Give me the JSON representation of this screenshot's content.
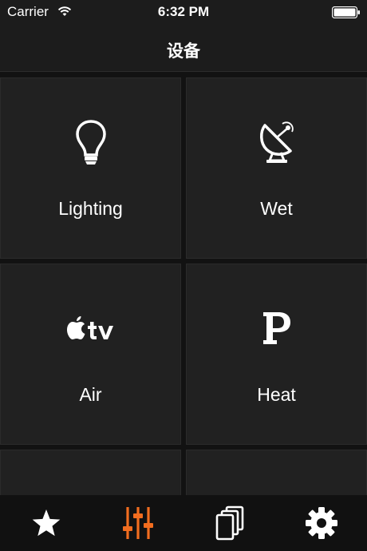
{
  "status_bar": {
    "carrier": "Carrier",
    "time": "6:32 PM",
    "wifi_icon": "wifi-icon",
    "battery_icon": "battery-icon"
  },
  "nav": {
    "title": "设备"
  },
  "devices": [
    {
      "label": "Lighting",
      "icon": "lightbulb-icon"
    },
    {
      "label": "Wet",
      "icon": "satellite-dish-icon"
    },
    {
      "label": "Air",
      "icon": "apple-tv-icon"
    },
    {
      "label": "Heat",
      "icon": "parking-icon"
    }
  ],
  "tabs": [
    {
      "icon": "star-icon",
      "selected": false
    },
    {
      "icon": "sliders-icon",
      "selected": true
    },
    {
      "icon": "copy-pages-icon",
      "selected": false
    },
    {
      "icon": "gear-icon",
      "selected": false
    }
  ],
  "colors": {
    "accent": "#f26d1f",
    "tile_background": "#212121",
    "background": "#121212"
  }
}
